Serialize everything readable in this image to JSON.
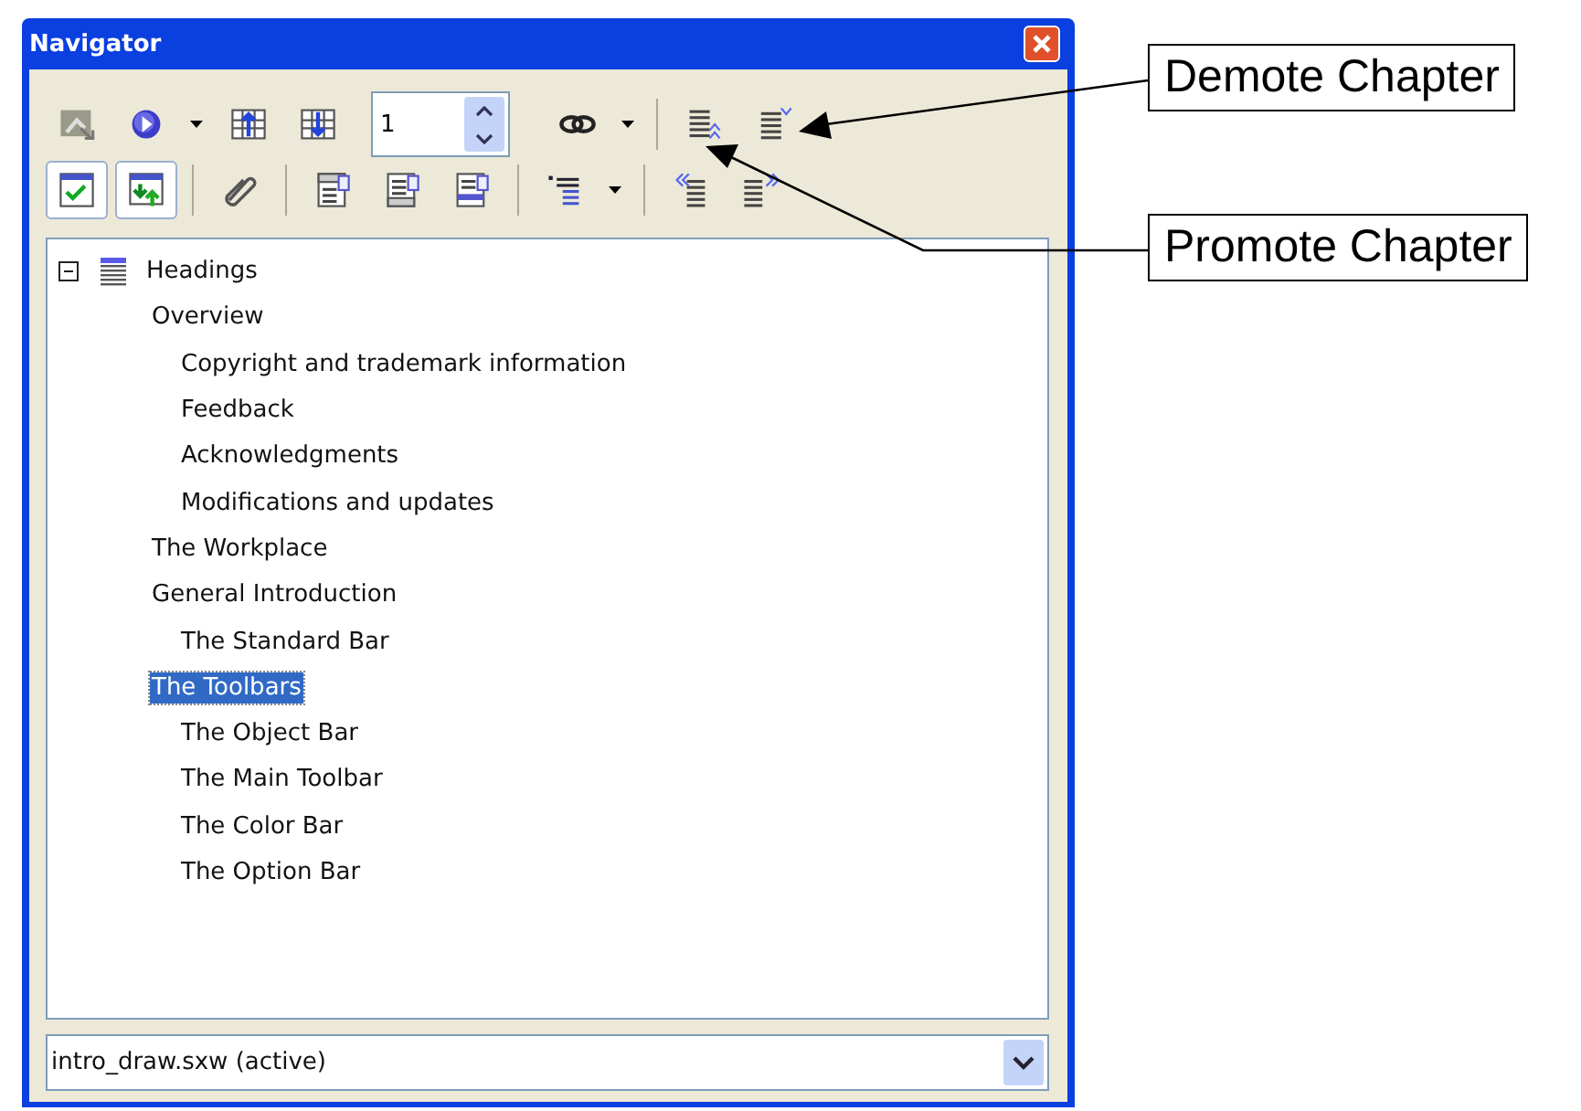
{
  "window": {
    "title": "Navigator"
  },
  "toolbar_rows": [
    [
      {
        "kind": "button"
      },
      {
        "kind": "button"
      },
      {
        "kind": "caret"
      },
      {
        "kind": "button"
      },
      {
        "kind": "button"
      },
      {
        "kind": "spin",
        "value": "1"
      },
      {
        "kind": "button"
      },
      {
        "kind": "caret"
      },
      {
        "kind": "separator"
      },
      {
        "kind": "button"
      },
      {
        "kind": "button"
      }
    ],
    [
      {
        "kind": "toggle",
        "pressed": true
      },
      {
        "kind": "toggle",
        "pressed": true
      },
      {
        "kind": "separator"
      },
      {
        "kind": "button"
      },
      {
        "kind": "separator"
      },
      {
        "kind": "button"
      },
      {
        "kind": "button"
      },
      {
        "kind": "button"
      },
      {
        "kind": "separator"
      },
      {
        "kind": "button"
      },
      {
        "kind": "caret"
      },
      {
        "kind": "separator"
      },
      {
        "kind": "button"
      },
      {
        "kind": "button"
      }
    ]
  ],
  "tree": [
    {
      "label": "Headings",
      "expanded": true,
      "selected": false,
      "children": [
        {
          "label": "Overview",
          "selected": false,
          "children": [
            {
              "label": "Copyright and trademark information",
              "selected": false
            },
            {
              "label": "Feedback",
              "selected": false
            },
            {
              "label": "Acknowledgments",
              "selected": false
            },
            {
              "label": "Modifications and updates",
              "selected": false
            }
          ]
        },
        {
          "label": "The Workplace",
          "selected": false
        },
        {
          "label": "General Introduction",
          "selected": false,
          "children": [
            {
              "label": "The Standard Bar",
              "selected": false
            }
          ]
        },
        {
          "label": "The Toolbars",
          "selected": true,
          "children": [
            {
              "label": "The Object Bar",
              "selected": false
            },
            {
              "label": "The Main Toolbar",
              "selected": false
            },
            {
              "label": "The Color Bar",
              "selected": false
            },
            {
              "label": "The Option Bar",
              "selected": false
            }
          ]
        }
      ]
    }
  ],
  "document_select": {
    "value": "intro_draw.sxw (active)"
  },
  "callouts": [
    {
      "text": "Demote Chapter"
    },
    {
      "text": "Promote Chapter"
    }
  ]
}
